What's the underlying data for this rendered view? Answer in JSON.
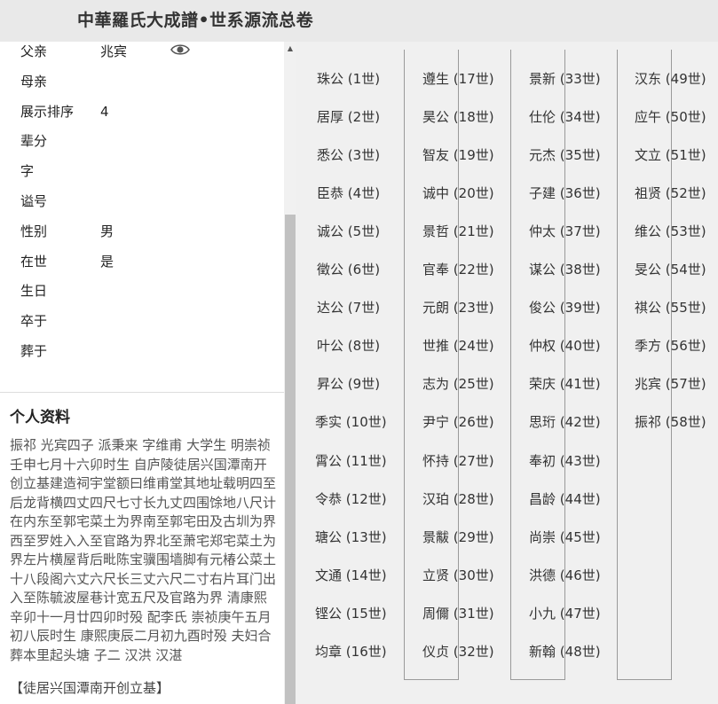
{
  "header": {
    "title": "中華羅氏大成譜•世系源流总卷"
  },
  "details": [
    {
      "label": "父亲",
      "value": "兆宾"
    },
    {
      "label": "母亲",
      "value": ""
    },
    {
      "label": "展示排序",
      "value": "4"
    },
    {
      "label": "辈分",
      "value": ""
    },
    {
      "label": "字",
      "value": ""
    },
    {
      "label": "谥号",
      "value": ""
    },
    {
      "label": "性别",
      "value": "男"
    },
    {
      "label": "在世",
      "value": "是"
    },
    {
      "label": "生日",
      "value": ""
    },
    {
      "label": "卒于",
      "value": ""
    },
    {
      "label": "葬于",
      "value": ""
    }
  ],
  "father_view_icon": "eye-icon",
  "profile": {
    "heading": "个人资料",
    "text": "振祁 光宾四子 派秉来 字维甫 大学生 明崇祯壬申七月十六卯时生 自庐陵徒居兴国潭南开创立基建造祠宇堂额曰维甫堂其地址载明四至后龙背横四丈四尺七寸长九丈四围馀地八尺计在内东至郭宅菜土为界南至郭宅田及古圳为界西至罗姓入入至官路为界北至萧宅郑宅菜土为界左片横屋背后毗陈宝骥围墙脚有元椿公菜土十八段阁六丈六尺长三丈六尺二寸右片耳门出入至陈毓波屋巷计宽五尺及官路为界 清康熙辛卯十一月廿四卯时殁 配李氏 崇祯庚午五月初八辰时生 康熙庚辰二月初九酉时殁 夫妇合葬本里起头塘 子二 汉洪 汉湛",
    "link": "【徒居兴国潭南开创立基】"
  },
  "generations": [
    {
      "name": "珠公",
      "gen": "(1世)"
    },
    {
      "name": "居厚",
      "gen": "(2世)"
    },
    {
      "name": "悉公",
      "gen": "(3世)"
    },
    {
      "name": "臣恭",
      "gen": "(4世)"
    },
    {
      "name": "诚公",
      "gen": "(5世)"
    },
    {
      "name": "徵公",
      "gen": "(6世)"
    },
    {
      "name": "达公",
      "gen": "(7世)"
    },
    {
      "name": "叶公",
      "gen": "(8世)"
    },
    {
      "name": "昇公",
      "gen": "(9世)"
    },
    {
      "name": "季实",
      "gen": "(10世)"
    },
    {
      "name": "霄公",
      "gen": "(11世)"
    },
    {
      "name": "令恭",
      "gen": "(12世)"
    },
    {
      "name": "瑭公",
      "gen": "(13世)"
    },
    {
      "name": "文通",
      "gen": "(14世)"
    },
    {
      "name": "铿公",
      "gen": "(15世)"
    },
    {
      "name": "均章",
      "gen": "(16世)"
    },
    {
      "name": "遵生",
      "gen": "(17世)"
    },
    {
      "name": "昊公",
      "gen": "(18世)"
    },
    {
      "name": "智友",
      "gen": "(19世)"
    },
    {
      "name": "诚中",
      "gen": "(20世)"
    },
    {
      "name": "景哲",
      "gen": "(21世)"
    },
    {
      "name": "官奉",
      "gen": "(22世)"
    },
    {
      "name": "元朗",
      "gen": "(23世)"
    },
    {
      "name": "世推",
      "gen": "(24世)"
    },
    {
      "name": "志为",
      "gen": "(25世)"
    },
    {
      "name": "尹宁",
      "gen": "(26世)"
    },
    {
      "name": "怀持",
      "gen": "(27世)"
    },
    {
      "name": "汉珀",
      "gen": "(28世)"
    },
    {
      "name": "景黻",
      "gen": "(29世)"
    },
    {
      "name": "立贤",
      "gen": "(30世)"
    },
    {
      "name": "周儞",
      "gen": "(31世)"
    },
    {
      "name": "仪贞",
      "gen": "(32世)"
    },
    {
      "name": "景新",
      "gen": "(33世)"
    },
    {
      "name": "仕伦",
      "gen": "(34世)"
    },
    {
      "name": "元杰",
      "gen": "(35世)"
    },
    {
      "name": "子建",
      "gen": "(36世)"
    },
    {
      "name": "仲太",
      "gen": "(37世)"
    },
    {
      "name": "谋公",
      "gen": "(38世)"
    },
    {
      "name": "俊公",
      "gen": "(39世)"
    },
    {
      "name": "仲权",
      "gen": "(40世)"
    },
    {
      "name": "荣庆",
      "gen": "(41世)"
    },
    {
      "name": "思珩",
      "gen": "(42世)"
    },
    {
      "name": "奉初",
      "gen": "(43世)"
    },
    {
      "name": "昌龄",
      "gen": "(44世)"
    },
    {
      "name": "尚崇",
      "gen": "(45世)"
    },
    {
      "name": "洪德",
      "gen": "(46世)"
    },
    {
      "name": "小九",
      "gen": "(47世)"
    },
    {
      "name": "新翰",
      "gen": "(48世)"
    },
    {
      "name": "汉东",
      "gen": "(49世)"
    },
    {
      "name": "应午",
      "gen": "(50世)"
    },
    {
      "name": "文立",
      "gen": "(51世)"
    },
    {
      "name": "祖贤",
      "gen": "(52世)"
    },
    {
      "name": "维公",
      "gen": "(53世)"
    },
    {
      "name": "旻公",
      "gen": "(54世)"
    },
    {
      "name": "祺公",
      "gen": "(55世)"
    },
    {
      "name": "季方",
      "gen": "(56世)"
    },
    {
      "name": "兆宾",
      "gen": "(57世)"
    },
    {
      "name": "振祁",
      "gen": "(58世)"
    }
  ]
}
